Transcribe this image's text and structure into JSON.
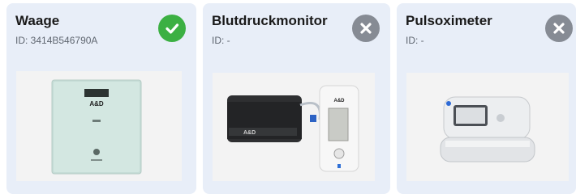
{
  "devices": [
    {
      "name": "Waage",
      "id_label": "ID: 3414B546790A",
      "status": "connected",
      "icon": "check-icon",
      "status_color": "#3cb043"
    },
    {
      "name": "Blutdruckmonitor",
      "id_label": "ID: -",
      "status": "not-connected",
      "icon": "close-icon",
      "status_color": "#868b94"
    },
    {
      "name": "Pulsoximeter",
      "id_label": "ID: -",
      "status": "not-connected",
      "icon": "close-icon",
      "status_color": "#868b94"
    }
  ],
  "brand": {
    "logo_text": "A&D"
  }
}
